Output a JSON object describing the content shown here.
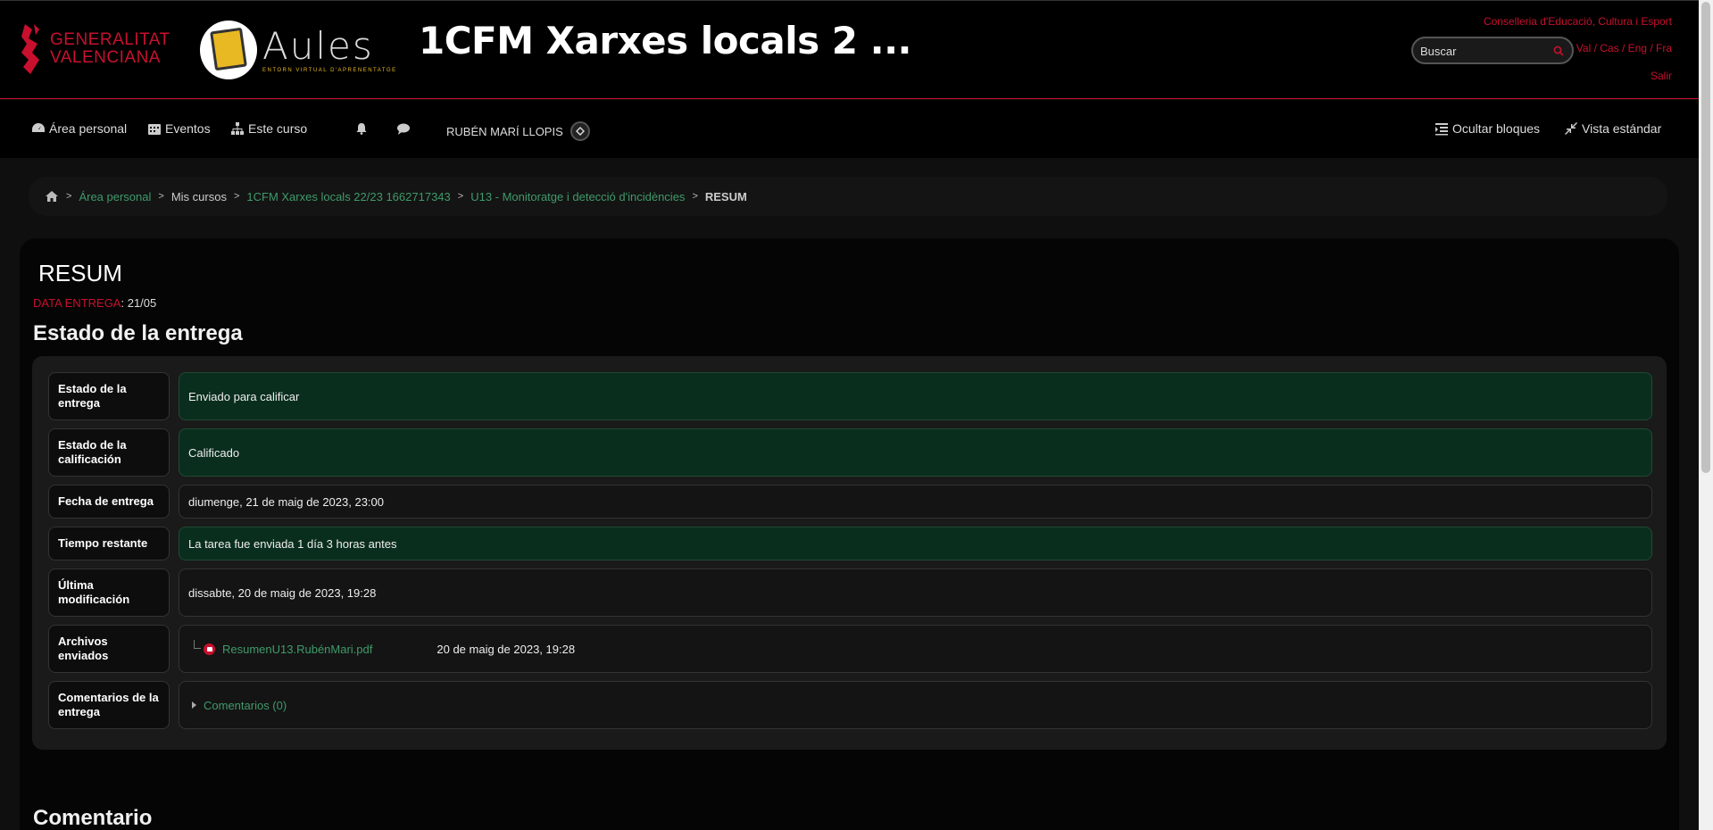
{
  "header": {
    "gva_logo_text_line1": "GENERALITAT",
    "gva_logo_text_line2": "VALENCIANA",
    "aules_word": "Aules",
    "aules_subtitle": "ENTORN VIRTUAL D'APRENENTATGE",
    "course_title": "1CFM Xarxes locals 2 ...",
    "conselleria": "Conselleria d'Educació, Cultura i Esport",
    "search_placeholder": "Buscar",
    "languages": [
      "Val",
      "Cas",
      "Eng",
      "Fra"
    ],
    "language_separator": " / ",
    "logout": "Salir"
  },
  "navbar": {
    "area_personal": "Área personal",
    "eventos": "Eventos",
    "este_curso": "Este curso",
    "user_name": "RUBÉN MARÍ LLOPIS",
    "hide_blocks": "Ocultar bloques",
    "standard_view": "Vista estándar"
  },
  "breadcrumb": {
    "items": [
      "Área personal",
      "Mis cursos",
      "1CFM Xarxes locals 22/23 1662717343",
      "U13 - Monitoratge i detecció d'incidències",
      "RESUM"
    ]
  },
  "main": {
    "title": "RESUM",
    "due_label": "DATA ENTREGA",
    "due_value": ": 21/05",
    "section_heading": "Estado de la entrega",
    "rows": [
      {
        "label": "Estado de la entrega",
        "value": "Enviado para calificar"
      },
      {
        "label": "Estado de la calificación",
        "value": "Calificado"
      },
      {
        "label": "Fecha de entrega",
        "value": "diumenge, 21 de maig de 2023, 23:00"
      },
      {
        "label": "Tiempo restante",
        "value": "La tarea fue enviada 1 día 3 horas antes"
      },
      {
        "label": "Última modificación",
        "value": "dissabte, 20 de maig de 2023, 19:28"
      },
      {
        "label": "Archivos enviados",
        "file_name": "ResumenU13.RubénMari.pdf",
        "file_date": "20 de maig de 2023, 19:28"
      },
      {
        "label": "Comentarios de la entrega",
        "value": "Comentarios (0)"
      }
    ],
    "comentario_heading": "Comentario"
  },
  "colors": {
    "brand_red": "#c8102e",
    "link_green": "#3f9a6a",
    "success_bg": "#0a2e1d"
  }
}
